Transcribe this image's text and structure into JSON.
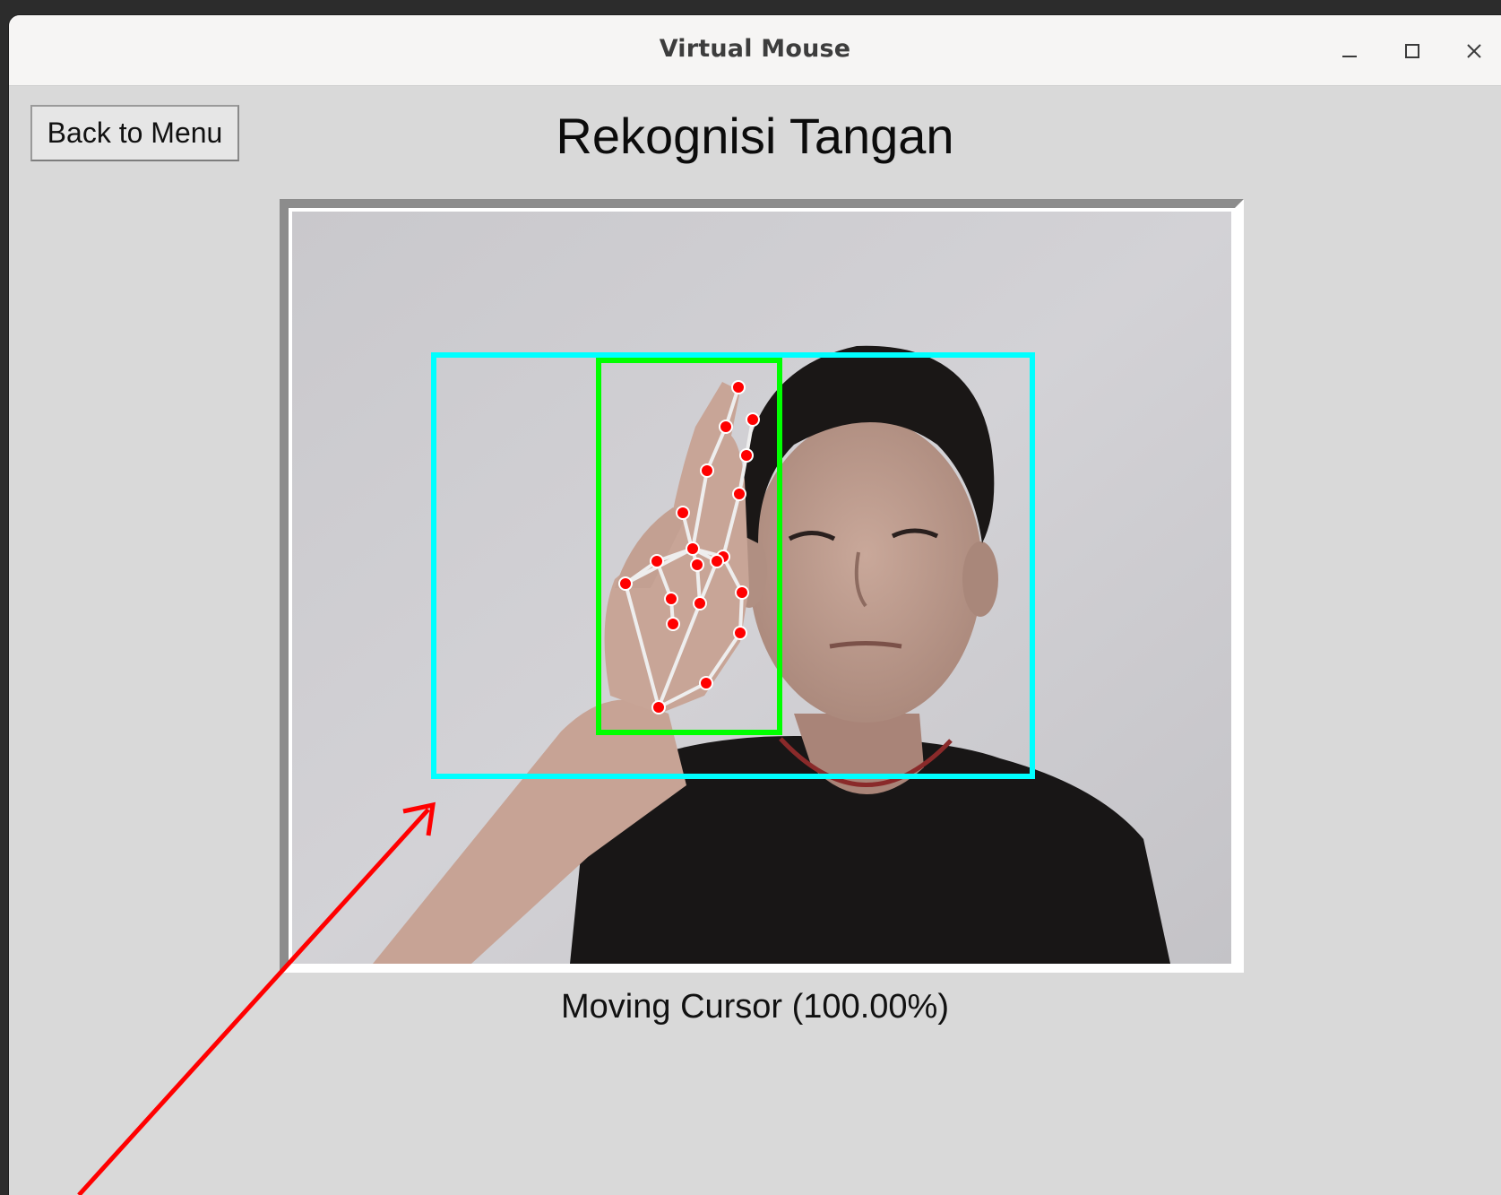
{
  "window": {
    "title": "Virtual Mouse",
    "controls": {
      "minimize": "minimize-icon",
      "maximize": "maximize-icon",
      "close": "close-icon"
    }
  },
  "toolbar": {
    "back_label": "Back to Menu"
  },
  "main": {
    "title": "Rekognisi Tangan",
    "status": "Moving Cursor (100.00%)"
  },
  "camera_feed": {
    "content": "webcam image of a person raising a hand gesture with hand landmarks drawn",
    "overlay_colors": {
      "active_area": "#00ffff",
      "hand_box": "#00ff00",
      "landmark": "#ff0000",
      "skeleton": "#f0f0f0"
    }
  },
  "annotation": {
    "arrow_color": "#ff0000"
  }
}
